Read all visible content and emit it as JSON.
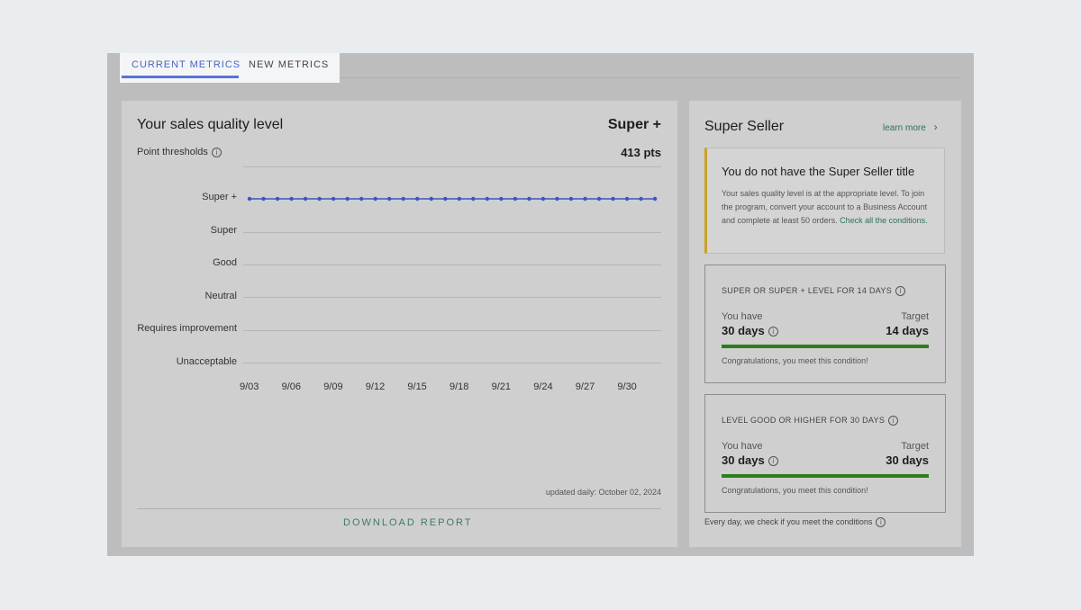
{
  "tabs": [
    {
      "label": "CURRENT METRICS",
      "active": true
    },
    {
      "label": "NEW METRICS",
      "active": false
    }
  ],
  "quality": {
    "title": "Your sales quality level",
    "level": "Super +",
    "thresholds_label": "Point thresholds",
    "points": "413 pts",
    "updated": "updated daily: October 02, 2024",
    "download_label": "DOWNLOAD REPORT"
  },
  "chart_data": {
    "type": "line",
    "y_categories": [
      "Super +",
      "Super",
      "Good",
      "Neutral",
      "Requires improvement",
      "Unacceptable"
    ],
    "x_ticks": [
      "9/03",
      "9/06",
      "9/09",
      "9/12",
      "9/15",
      "9/18",
      "9/21",
      "9/24",
      "9/27",
      "9/30"
    ],
    "x_start_day": 3,
    "series": [
      {
        "color": "#3b55c0",
        "values": [
          "Super +",
          "Super +",
          "Super +",
          "Super +",
          "Super +",
          "Super +",
          "Super +",
          "Super +",
          "Super +",
          "Super +",
          "Super +",
          "Super +",
          "Super +",
          "Super +",
          "Super +",
          "Super +",
          "Super +",
          "Super +",
          "Super +",
          "Super +",
          "Super +",
          "Super +",
          "Super +",
          "Super +",
          "Super +",
          "Super +",
          "Super +",
          "Super +",
          "Super +",
          "Super +"
        ]
      }
    ]
  },
  "super_seller": {
    "title": "Super Seller",
    "learn_more": "learn more",
    "notice_title": "You do not have the Super Seller title",
    "notice_text": "Your sales quality level is at the appropriate level. To join the program, convert your account to a Business Account and complete at least 50 orders.",
    "notice_link": "Check all the conditions.",
    "conditions": [
      {
        "title": "SUPER OR SUPER + LEVEL FOR 14 DAYS",
        "you_have_label": "You have",
        "you_have": "30 days",
        "target_label": "Target",
        "target": "14 days",
        "progress": 1.0,
        "message": "Congratulations, you meet this condition!"
      },
      {
        "title": "LEVEL GOOD OR HIGHER FOR 30 DAYS",
        "you_have_label": "You have",
        "you_have": "30 days",
        "target_label": "Target",
        "target": "30 days",
        "progress": 1.0,
        "message": "Congratulations, you meet this condition!"
      }
    ],
    "footer": "Every day, we check if you meet the conditions"
  },
  "colors": {
    "accent": "#4a63c9",
    "progress": "#2e7d1f",
    "notice_border": "#c9a227",
    "link": "#2f6f5e"
  }
}
